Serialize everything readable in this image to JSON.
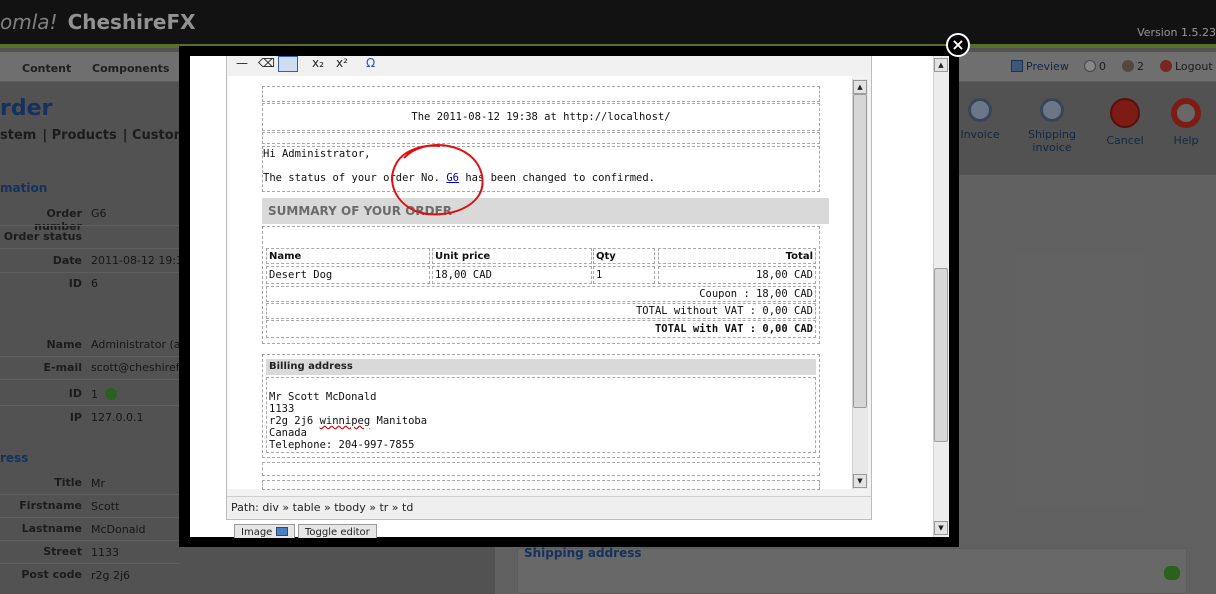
{
  "header": {
    "logo_text": "omla!",
    "site_name": "CheshireFX",
    "version": "Version 1.5.23"
  },
  "menu": {
    "items": [
      "Content",
      "Components"
    ],
    "status": {
      "preview": "Preview",
      "messages": "0",
      "users": "2",
      "logout": "Logout"
    }
  },
  "page": {
    "title": "rder",
    "subnav": [
      "stem",
      "Products",
      "Customers"
    ]
  },
  "toolbar": {
    "invoice": "Invoice",
    "shipping_invoice": "Shipping invoice",
    "cancel": "Cancel",
    "help": "Help"
  },
  "order_info": {
    "section": "mation",
    "order_number_label": "Order number",
    "order_number": "G6",
    "order_status_label": "Order status",
    "date_label": "Date",
    "date": "2011-08-12 19:34",
    "id_label": "ID",
    "id": "6"
  },
  "customer": {
    "name_label": "Name",
    "name": "Administrator (adm",
    "email_label": "E-mail",
    "email": "scott@cheshirefx",
    "id_label": "ID",
    "id": "1",
    "ip_label": "IP",
    "ip": "127.0.0.1"
  },
  "address": {
    "section": "ress",
    "title_label": "Title",
    "title": "Mr",
    "firstname_label": "Firstname",
    "firstname": "Scott",
    "lastname_label": "Lastname",
    "lastname": "McDonald",
    "street_label": "Street",
    "street": "1133",
    "postcode_label": "Post code",
    "postcode": "r2g 2j6"
  },
  "shipping": {
    "title": "Shipping address"
  },
  "editor": {
    "timestamp_line": "The 2011-08-12 19:38 at http://localhost/",
    "greeting": "Hi Administrator,",
    "status_prefix": "The status of your order No.",
    "order_link": "G6",
    "status_suffix": "has been changed to confirmed.",
    "summary_title": "SUMMARY OF YOUR ORDER",
    "table": {
      "headers": [
        "Name",
        "Unit price",
        "Qty",
        "Total"
      ],
      "rows": [
        [
          "Desert Dog",
          "18,00 CAD",
          "1",
          "18,00 CAD"
        ]
      ],
      "coupon": "Coupon : 18,00 CAD",
      "total_without_vat": "TOTAL without VAT : 0,00 CAD",
      "total_with_vat": "TOTAL with VAT : 0,00 CAD"
    },
    "billing_title": "Billing address",
    "billing_lines": [
      "Mr Scott McDonald",
      "1133",
      "r2g 2j6",
      "winnipeg",
      "Manitoba",
      "Canada",
      "Telephone: 204-997-7855"
    ],
    "path_label": "Path:",
    "path": "div » table » tbody » tr » td",
    "buttons": {
      "image": "Image",
      "toggle": "Toggle editor"
    }
  }
}
